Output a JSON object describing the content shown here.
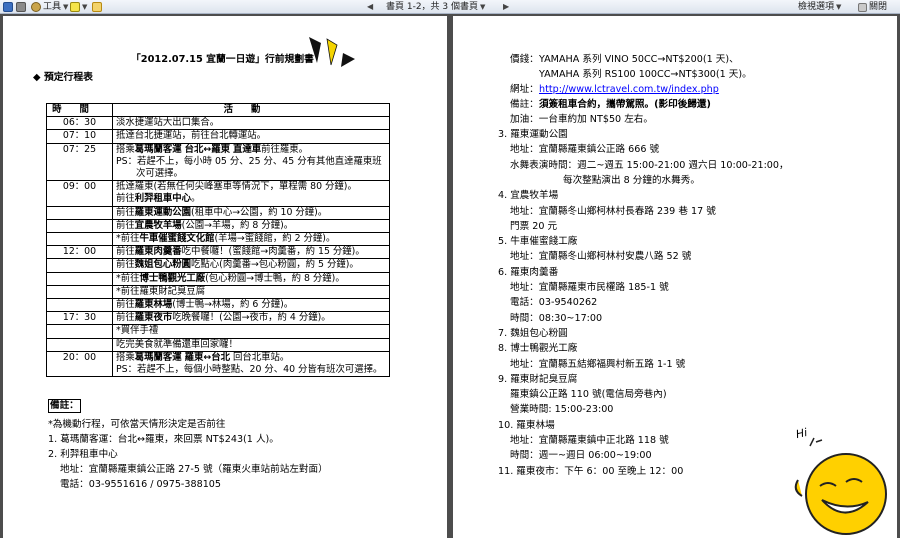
{
  "toolbar": {
    "tools_label": "工具",
    "page_status": "書頁 1-2，共 3 個書頁",
    "view_options_label": "檢視選項",
    "close_label": "關閉"
  },
  "page1": {
    "title": "「2012.07.15 宜蘭一日遊」行前規劃書",
    "section_heading": "◆ 預定行程表",
    "table_headers": {
      "time": "時間",
      "activity": "活動"
    },
    "rows": [
      {
        "time": "06：30",
        "lines": [
          "淡水捷運站大出口集合。"
        ]
      },
      {
        "time": "07：10",
        "lines": [
          "抵達台北捷運站，前往台北轉運站。"
        ]
      },
      {
        "time": "07：25",
        "lines": [
          "搭乘葛瑪蘭客運 台北↔羅東 直達車前往羅東。",
          "PS：若趕不上，每小時 05 分、25 分、45 分有其他直達羅東班",
          "次可選擇。"
        ]
      },
      {
        "time": "09：00",
        "lines": [
          "抵達羅東(若無任何尖峰塞車等情況下，單程需 80 分鐘)。",
          "前往利羿租車中心。"
        ]
      },
      {
        "time": "",
        "lines": [
          "前往羅東運動公園(租車中心→公園，約 10 分鐘)。"
        ]
      },
      {
        "time": "",
        "lines": [
          "前往宜農牧羊場(公園→羊場，約 8 分鐘)。"
        ]
      },
      {
        "time": "",
        "lines": [
          "*前往牛車催蜜餞文化館(羊場→蜜餞館，約 2 分鐘)。"
        ]
      },
      {
        "time": "12：00",
        "lines": [
          "前往羅東肉羹番吃中餐囉！(蜜餞館→肉羹番，約 15 分鐘)。"
        ]
      },
      {
        "time": "",
        "lines": [
          "前往魏姐包心粉圓吃點心(肉羹番→包心粉圓，約 5 分鐘)。"
        ]
      },
      {
        "time": "",
        "lines": [
          "*前往博士鴨觀光工廠(包心粉圓→博士鴨，約 8 分鐘)。"
        ]
      },
      {
        "time": "",
        "lines": [
          "*前往羅東財記臭豆腐"
        ]
      },
      {
        "time": "",
        "lines": [
          "前往羅東林場(博士鴨→林場，約 6 分鐘)。"
        ]
      },
      {
        "time": "17：30",
        "lines": [
          "前往羅東夜市吃晚餐囉！(公園→夜市，約 4 分鐘)。"
        ]
      },
      {
        "time": "",
        "lines": [
          "*買伴手禮"
        ]
      },
      {
        "time": "",
        "lines": [
          "吃完美食就準備還車回家囉！"
        ]
      },
      {
        "time": "20：00",
        "lines": [
          "搭乘葛瑪蘭客運 羅東↔台北 回台北車站。",
          "PS：若趕不上，每個小時整點、20 分、40 分皆有班次可選擇。"
        ]
      }
    ],
    "notes_heading": "備註：",
    "notes": [
      "*為機動行程，可依當天情形決定是否前往",
      "1. 葛瑪蘭客運：台北↔羅東，來回票 NT$243(1 人)。",
      "2. 利羿租車中心",
      "地址：宜蘭縣羅東鎮公正路 27-5 號（羅東火車站前站左對面）",
      "電話：03-9551616 / 0975-388105"
    ]
  },
  "page2": {
    "price_label": "價錢：",
    "price_line1": "YAMAHA 系列 VINO 50CC→NT$200(1 天)、",
    "price_line2": "YAMAHA 系列 RS100 100CC→NT$300(1 天)。",
    "website_label": "網址：",
    "website_url": "http://www.lctravel.com.tw/index.php",
    "remark_label": "備註：",
    "remark_text": "須簽租車合約，攜帶駕照。(影印後歸還)",
    "fuel": "加油：一台車約加 NT$50 左右。",
    "items": [
      {
        "title": "3. 羅東運動公園",
        "lines": [
          "地址：宜蘭縣羅東鎮公正路 666 號",
          "水舞表演時間：週二~週五 15:00-21:00 週六日 10:00-21:00，",
          "每次整點演出 8 分鐘的水舞秀。"
        ]
      },
      {
        "title": "4. 宜農牧羊場",
        "lines": [
          "地址：宜蘭縣冬山鄉柯林村長春路 239 巷 17 號",
          "門票 20 元"
        ]
      },
      {
        "title": "5. 牛車催蜜餞工廠",
        "lines": [
          "地址：宜蘭縣冬山鄉柯林村安農八路 52 號"
        ]
      },
      {
        "title": "6. 羅東肉羹番",
        "lines": [
          "地址：宜蘭縣羅東市民權路 185-1 號",
          "電話：03-9540262",
          "時間：08:30~17:00"
        ]
      },
      {
        "title": "7. 魏姐包心粉圓",
        "lines": []
      },
      {
        "title": "8. 博士鴨觀光工廠",
        "lines": [
          "地址：宜蘭縣五結鄉福興村新五路 1-1 號"
        ]
      },
      {
        "title": "9. 羅東財記臭豆腐",
        "lines": [
          "羅東鎮公正路 110 號(電信局旁巷內)",
          "營業時間: 15:00-23:00"
        ]
      },
      {
        "title": "10.  羅東林場",
        "lines": [
          "地址：宜蘭縣羅東鎮中正北路 118 號",
          "時間：週一~週日 06:00~19:00"
        ]
      },
      {
        "title": "11. 羅東夜市：下午 6：00 至晚上 12：00",
        "lines": []
      }
    ],
    "smiley_text": "Hi"
  }
}
